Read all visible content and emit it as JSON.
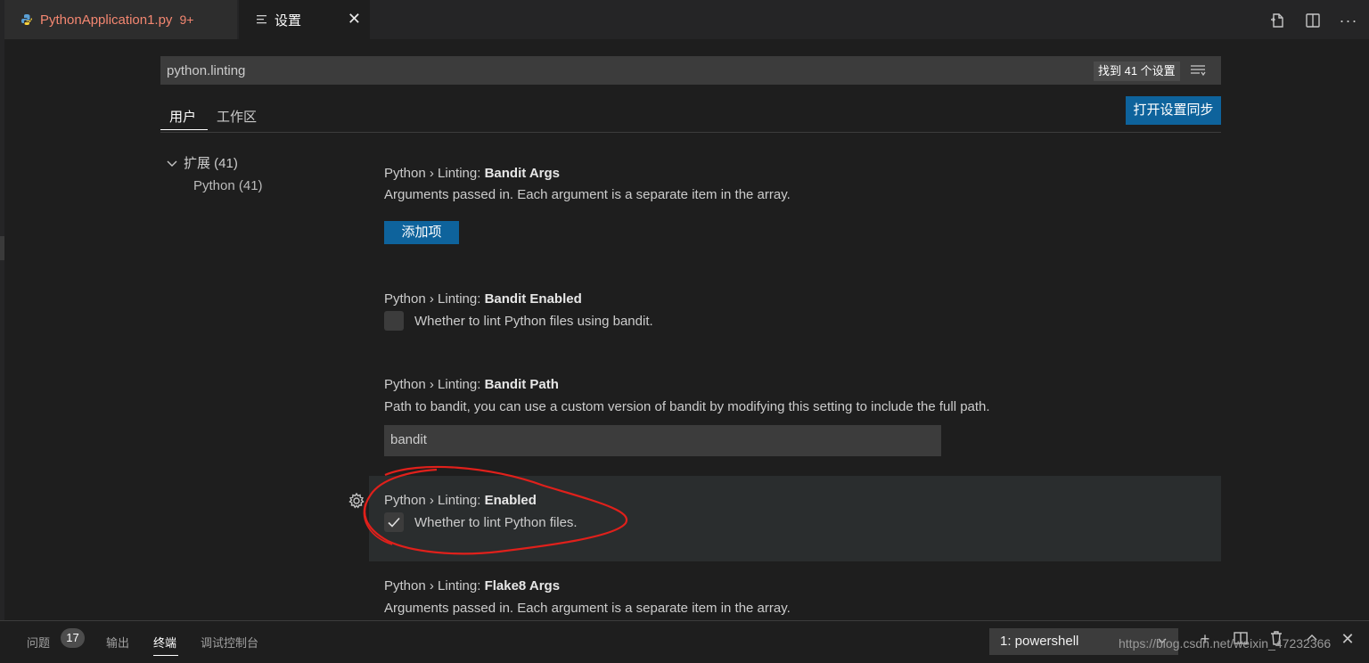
{
  "tabs": [
    {
      "label": "PythonApplication1.py",
      "count": "9+"
    },
    {
      "label": "设置"
    }
  ],
  "search": {
    "value": "python.linting",
    "found": "找到 41 个设置"
  },
  "scopes": {
    "user": "用户",
    "workspace": "工作区"
  },
  "sync_button": "打开设置同步",
  "toc": {
    "extensions": "扩展 (41)",
    "python": "Python (41)"
  },
  "settings": [
    {
      "prefix": "Python › Linting: ",
      "name": "Bandit Args",
      "desc": "Arguments passed in. Each argument is a separate item in the array.",
      "button": "添加项"
    },
    {
      "prefix": "Python › Linting: ",
      "name": "Bandit Enabled",
      "desc": "Whether to lint Python files using bandit.",
      "checked": false
    },
    {
      "prefix": "Python › Linting: ",
      "name": "Bandit Path",
      "desc": "Path to bandit, you can use a custom version of bandit by modifying this setting to include the full path.",
      "value": "bandit"
    },
    {
      "prefix": "Python › Linting: ",
      "name": "Enabled",
      "desc": "Whether to lint Python files.",
      "checked": true
    },
    {
      "prefix": "Python › Linting: ",
      "name": "Flake8 Args",
      "desc": "Arguments passed in. Each argument is a separate item in the array."
    }
  ],
  "panel": {
    "problems": "问题",
    "problems_count": "17",
    "output": "输出",
    "terminal": "终端",
    "debug_console": "调试控制台",
    "terminal_select": "1: powershell"
  },
  "watermark": "https://blog.csdn.net/weixin_47232366",
  "icons": {
    "python_file": "python-file-icon",
    "settings_file": "settings-file-icon",
    "toolbar": [
      "open-settings-json-icon",
      "split-editor-icon",
      "more-actions-icon"
    ],
    "panel": [
      "add-terminal-icon",
      "split-terminal-icon",
      "trash-icon",
      "maximize-panel-icon",
      "close-panel-icon"
    ]
  },
  "colors": {
    "accent": "#0e639c",
    "tab_modified": "#f48771",
    "annotation": "#e0201b"
  }
}
